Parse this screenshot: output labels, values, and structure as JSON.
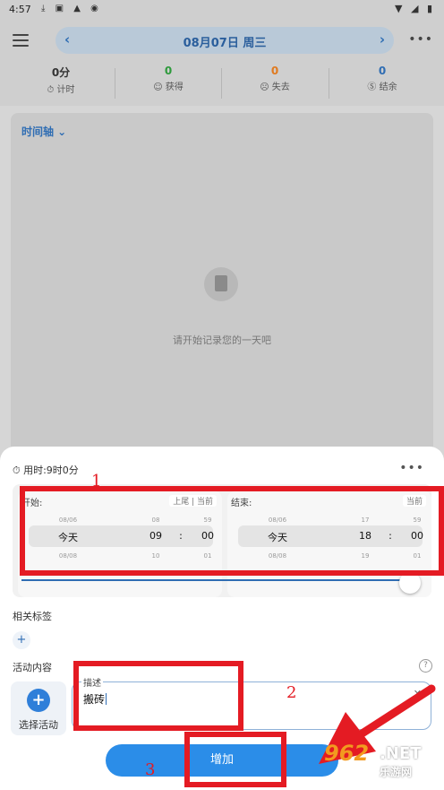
{
  "status_bar": {
    "time": "4:57",
    "left_icons": "⤓ ▣ ▲ ◉",
    "right_icons": "▼ ◢ ▮"
  },
  "header": {
    "prev": "‹",
    "date": "08月07日  周三",
    "next": "›",
    "more": "•••"
  },
  "stats": [
    {
      "value": "0分",
      "label": "⏱ 计时",
      "color": "#333333"
    },
    {
      "value": "0",
      "label": "☺ 获得",
      "color": "#2e9a3c"
    },
    {
      "value": "0",
      "label": "☹ 失去",
      "color": "#e07a1f"
    },
    {
      "value": "0",
      "label": "Ⓢ 结余",
      "color": "#2f6db3"
    }
  ],
  "timeline": {
    "title": "时间轴 ⌄",
    "empty": "请开始记录您的一天吧"
  },
  "sheet": {
    "used_time": "⏱ 用时:9时0分",
    "more": "•••",
    "start": {
      "label": "开始:",
      "chip_prev": "上尾",
      "chip_now": "当前",
      "prev_row": [
        "08/06",
        "08",
        "59"
      ],
      "selected": [
        "今天",
        "09",
        ":",
        "00"
      ],
      "next_row": [
        "08/08",
        "10",
        "01"
      ]
    },
    "end": {
      "label": "结束:",
      "chip_now": "当前",
      "prev_row": [
        "08/06",
        "17",
        "59"
      ],
      "selected": [
        "今天",
        "18",
        ":",
        "00"
      ],
      "next_row": [
        "08/08",
        "19",
        "01"
      ]
    },
    "tags_label": "相关标签",
    "add_tag": "+",
    "activity_label": "活动内容",
    "help": "?",
    "choose_plus": "+",
    "choose_label": "选择活动",
    "desc_label": "描述",
    "desc_value": "搬砖",
    "clear": "✕",
    "add_button": "增加"
  },
  "annotations": {
    "n1": "1",
    "n2": "2",
    "n3": "3",
    "accent": "#e41b23"
  },
  "watermark": {
    "brand": "962",
    "suffix": ".NET",
    "sub": "乐游网"
  }
}
